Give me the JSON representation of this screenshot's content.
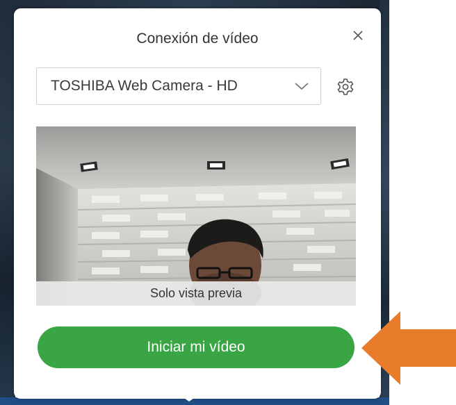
{
  "dialog": {
    "title": "Conexión de vídeo",
    "close_icon": "close-icon"
  },
  "camera_select": {
    "selected_value": "TOSHIBA Web Camera - HD",
    "chevron_icon": "chevron-down-icon",
    "settings_icon": "gear-icon"
  },
  "preview": {
    "overlay_label": "Solo vista previa"
  },
  "actions": {
    "start_video_label": "Iniciar mi vídeo"
  },
  "colors": {
    "primary_button": "#3aa545",
    "annotation_arrow": "#e87c2a",
    "background_dark": "#1f2c3a"
  }
}
